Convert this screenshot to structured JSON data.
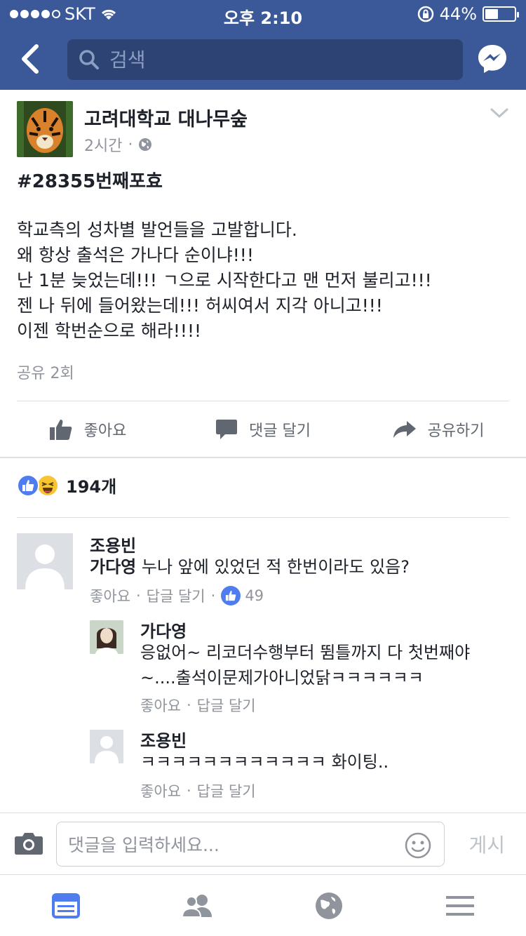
{
  "status": {
    "carrier": "SKT",
    "time": "오후 2:10",
    "battery": "44%",
    "battery_level": 0.44
  },
  "nav": {
    "search_placeholder": "검색"
  },
  "post": {
    "page_name": "고려대학교 대나무숲",
    "time": "2시간",
    "hashtag": "#28355번째포효",
    "lines": [
      "학교측의 성차별 발언들을 고발합니다.",
      "왜 항상 출석은 가나다 순이냐!!!",
      "난 1분 늦었는데!!! ㄱ으로 시작한다고 맨 먼저 불리고!!!",
      "젠 나 뒤에 들어왔는데!!! 허씨여서 지각 아니고!!!",
      "이젠 학번순으로 해라!!!!"
    ],
    "shares": "공유 2회"
  },
  "actions": {
    "like": "좋아요",
    "comment": "댓글 달기",
    "share": "공유하기"
  },
  "reactions": {
    "count": "194개"
  },
  "comments": [
    {
      "name": "조용빈",
      "tag": "가다영",
      "text": " 누나 앞에 있었던 적 한번이라도 있음?",
      "like": "좋아요",
      "reply": "답글 달기",
      "likes": "49"
    },
    {
      "name": "가다영",
      "line1": "응없어~ 리코더수행부터 뜀틀까지 다 첫번째야",
      "line2": "~....출석이문제가아니었닭ㅋㅋㅋㅋㅋㅋ",
      "like": "좋아요",
      "reply": "답글 달기"
    },
    {
      "name": "조용빈",
      "text": "ㅋㅋㅋㅋㅋㅋㅋㅋㅋㅋㅋㅋ 화이팅..",
      "like": "좋아요",
      "reply": "답글 달기"
    }
  ],
  "composer": {
    "placeholder": "댓글을 입력하세요...",
    "post_label": "게시"
  },
  "colors": {
    "brand": "#3b5998",
    "like_blue": "#4f7df0",
    "meta_gray": "#90949c"
  }
}
